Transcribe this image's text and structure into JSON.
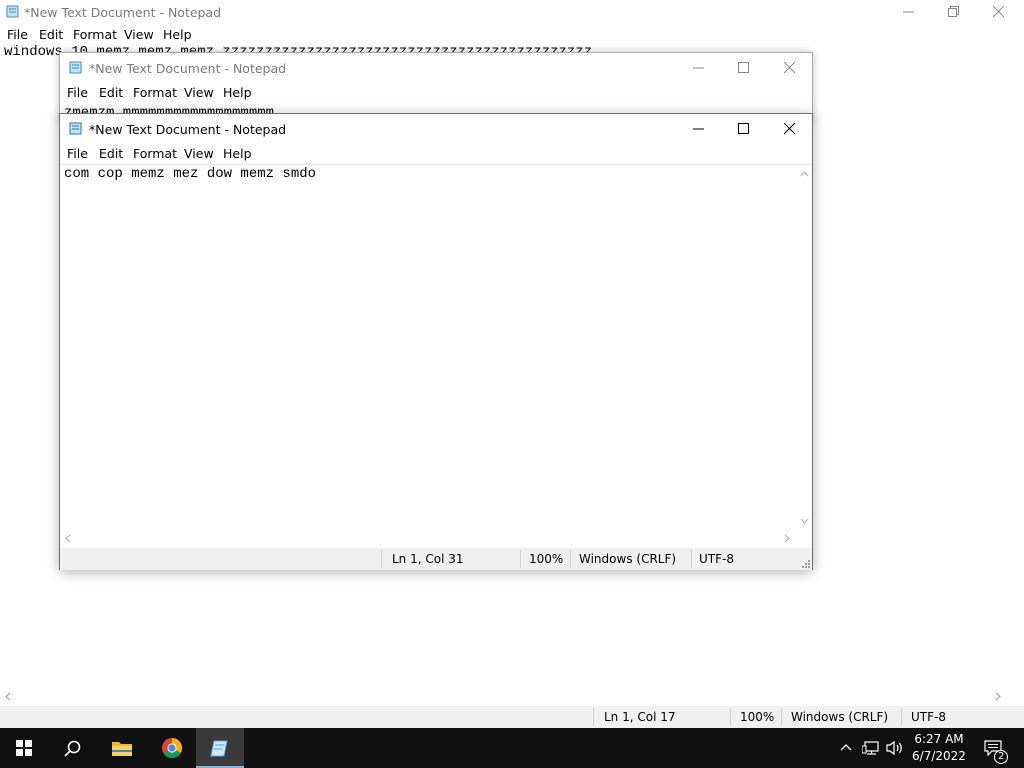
{
  "back_window": {
    "title": "*New Text Document - Notepad",
    "menu": [
      "File",
      "Edit",
      "Format",
      "View",
      "Help"
    ],
    "text": "windows 10 memz memz memz zzzzzzzzzzzzzzzzzzzzzzzzzzzzzzzzzzzzzzzzzzzz",
    "status": {
      "position": "Ln 1, Col 17",
      "zoom": "100%",
      "line_ending": "Windows (CRLF)",
      "encoding": "UTF-8"
    }
  },
  "middle_window": {
    "title": "*New Text Document - Notepad",
    "menu": [
      "File",
      "Edit",
      "Format",
      "View",
      "Help"
    ],
    "text": "zmemzm mmmmmmmmmmmmmmmmmm"
  },
  "front_window": {
    "title": "*New Text Document - Notepad",
    "menu": [
      "File",
      "Edit",
      "Format",
      "View",
      "Help"
    ],
    "text": "com cop memz mez dow memz smdo",
    "status": {
      "position": "Ln 1, Col 31",
      "zoom": "100%",
      "line_ending": "Windows (CRLF)",
      "encoding": "UTF-8"
    }
  },
  "taskbar": {
    "apps": [
      "start-icon",
      "search-icon",
      "file-explorer-icon",
      "chrome-icon",
      "notepad-icon"
    ],
    "time": "6:27 AM",
    "date": "6/7/2022",
    "notification_count": "2"
  },
  "colors": {
    "taskbar": "#101010",
    "title_inactive": "#7a7a7a",
    "status_bg": "#f0f0f0"
  }
}
